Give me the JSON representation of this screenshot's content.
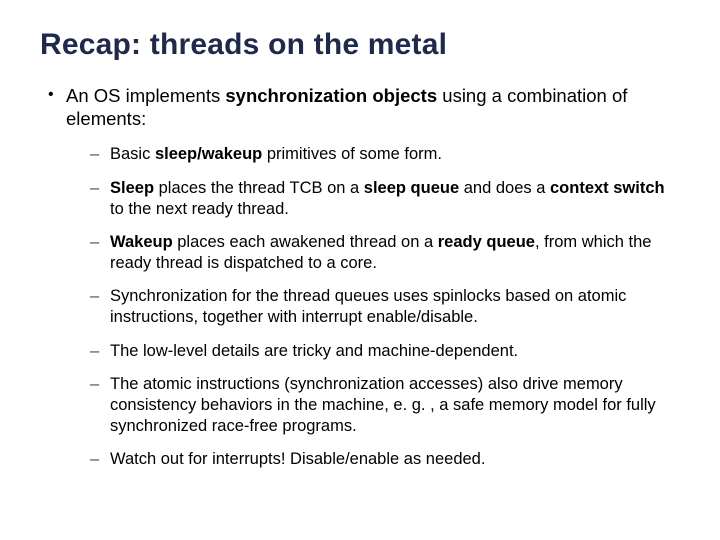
{
  "title": "Recap: threads on the metal",
  "lead": {
    "pre": "An OS implements ",
    "bold": "synchronization objects",
    "post": " using a combination of elements:"
  },
  "items": [
    {
      "pre": "Basic ",
      "b1": "sleep/wakeup",
      "post": " primitives of some form."
    },
    {
      "b1": "Sleep",
      "mid1": " places the thread TCB on a ",
      "b2": "sleep queue",
      "mid2": " and does a ",
      "b3": "context switch",
      "post": " to the next ready thread."
    },
    {
      "b1": "Wakeup",
      "mid1": " places each awakened thread on a ",
      "b2": "ready queue",
      "post": ", from which the ready thread is dispatched to a core."
    },
    {
      "plain": "Synchronization for the thread queues uses spinlocks based on atomic instructions, together with interrupt enable/disable."
    },
    {
      "plain": "The low-level details are tricky and machine-dependent."
    },
    {
      "plain": "The atomic instructions (synchronization accesses) also drive memory consistency behaviors in the machine, e. g. , a safe memory model for fully synchronized race-free programs."
    },
    {
      "plain": "Watch out for interrupts!  Disable/enable as needed."
    }
  ]
}
